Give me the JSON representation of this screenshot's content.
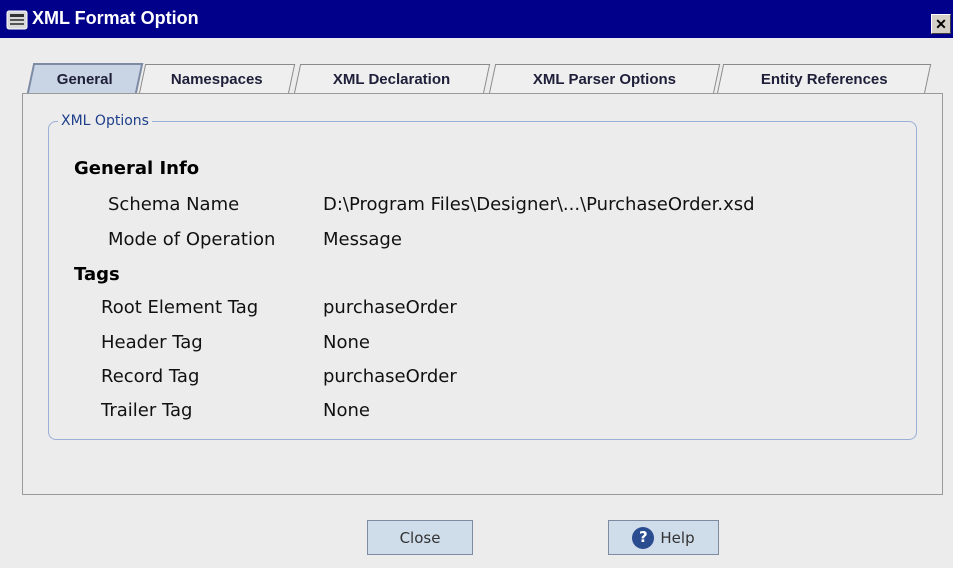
{
  "window": {
    "title": "XML Format Option"
  },
  "tabs": [
    {
      "label": "General"
    },
    {
      "label": "Namespaces"
    },
    {
      "label": "XML Declaration"
    },
    {
      "label": "XML Parser Options"
    },
    {
      "label": "Entity References"
    }
  ],
  "options": {
    "legend": "XML Options",
    "general_info": {
      "heading": "General Info",
      "schema_name": {
        "label": "Schema Name",
        "value": "D:\\Program Files\\Designer\\...\\PurchaseOrder.xsd"
      },
      "mode_of_operation": {
        "label": "Mode of Operation",
        "value": "Message"
      }
    },
    "tags": {
      "heading": "Tags",
      "root_element": {
        "label": "Root Element Tag",
        "value": "purchaseOrder"
      },
      "header": {
        "label": "Header Tag",
        "value": "None"
      },
      "record": {
        "label": "Record Tag",
        "value": "purchaseOrder"
      },
      "trailer": {
        "label": "Trailer Tag",
        "value": "None"
      }
    }
  },
  "buttons": {
    "close": "Close",
    "help": "Help"
  },
  "icons": {
    "title": "xml-document-icon",
    "help": "help-icon",
    "close": "close-icon"
  },
  "colors": {
    "titlebar": "#00008a",
    "accent": "#1f3f8a",
    "button": "#cfdcea"
  }
}
